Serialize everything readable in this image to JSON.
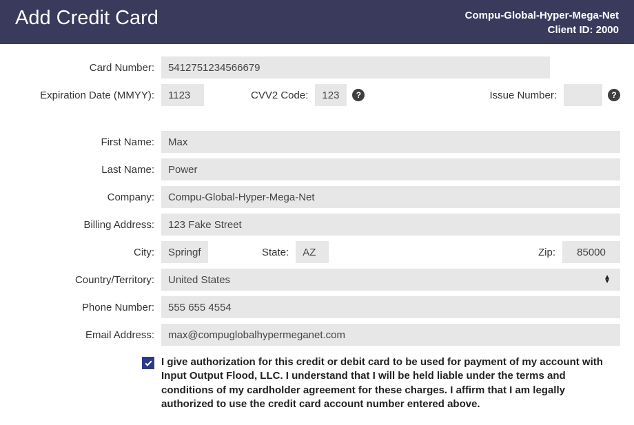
{
  "header": {
    "title": "Add Credit Card",
    "company": "Compu-Global-Hyper-Mega-Net",
    "client_id_line": "Client ID: 2000"
  },
  "labels": {
    "card_number": "Card Number:",
    "expiration": "Expiration Date (MMYY):",
    "cvv": "CVV2 Code:",
    "issue": "Issue Number:",
    "first_name": "First Name:",
    "last_name": "Last Name:",
    "company": "Company:",
    "billing_address": "Billing Address:",
    "city": "City:",
    "state": "State:",
    "zip": "Zip:",
    "country": "Country/Territory:",
    "phone": "Phone Number:",
    "email": "Email Address:"
  },
  "values": {
    "card_number": "5412751234566679",
    "expiration": "1123",
    "cvv": "123",
    "issue": "",
    "first_name": "Max",
    "last_name": "Power",
    "company": "Compu-Global-Hyper-Mega-Net",
    "billing_address": "123 Fake Street",
    "city": "Springfield",
    "state": "AZ",
    "zip": "85000",
    "country": "United States",
    "phone": "555 655 4554",
    "email": "max@compuglobalhypermeganet.com"
  },
  "authorization_text": "I give authorization for this credit or debit card to be used for payment of my account with Input Output Flood, LLC. I understand that I will be held liable under the terms and conditions of my cardholder agreement for these charges. I affirm that I am legally authorized to use the credit card account number entered above.",
  "help_glyph": "?"
}
